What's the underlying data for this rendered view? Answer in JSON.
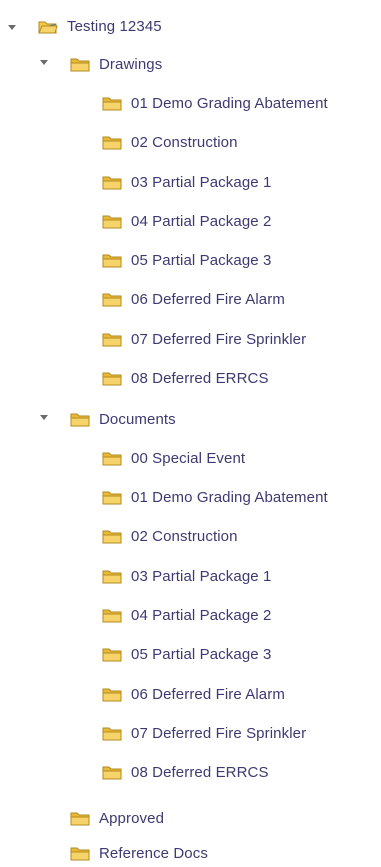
{
  "tree": {
    "root": {
      "label": "Testing 12345",
      "expanded": true,
      "icon": "project-folder-icon"
    },
    "drawings": {
      "label": "Drawings",
      "expanded": true,
      "items": [
        "01 Demo Grading Abatement",
        "02 Construction",
        "03 Partial Package 1",
        "04 Partial Package 2",
        "05 Partial Package 3",
        "06 Deferred Fire Alarm",
        "07 Deferred Fire Sprinkler",
        "08 Deferred ERRCS"
      ]
    },
    "documents": {
      "label": "Documents",
      "expanded": true,
      "items": [
        "00 Special Event",
        "01 Demo Grading Abatement",
        "02 Construction",
        "03 Partial Package 1",
        "04 Partial Package 2",
        "05 Partial Package 3",
        "06 Deferred Fire Alarm",
        "07 Deferred Fire Sprinkler",
        "08 Deferred ERRCS"
      ]
    },
    "approved": {
      "label": "Approved"
    },
    "reference_docs": {
      "label": "Reference Docs"
    }
  },
  "colors": {
    "label_text": "#3d3a72",
    "folder_fill": "#f2c94c",
    "folder_edge": "#b58a1e",
    "chevron": "#6b6b6b"
  }
}
